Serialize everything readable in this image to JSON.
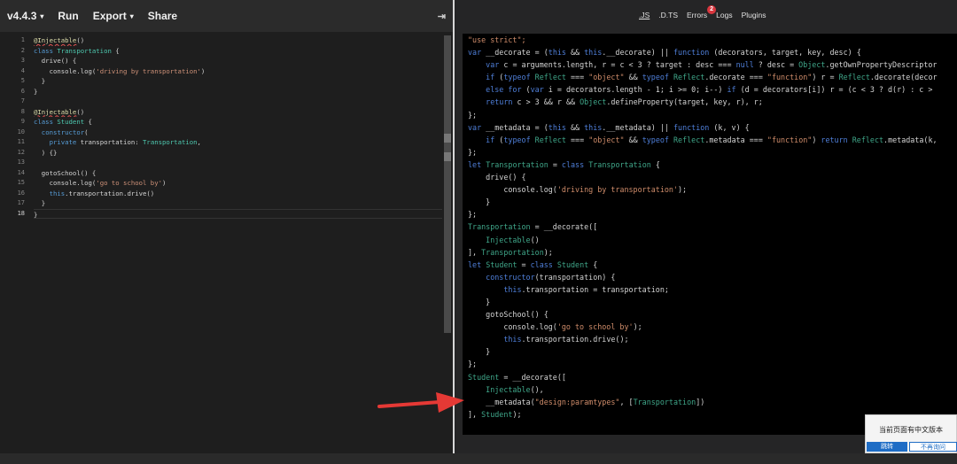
{
  "toolbar": {
    "version_label": "v4.4.3",
    "run_label": "Run",
    "export_label": "Export",
    "share_label": "Share",
    "collapse_glyph": "⇥",
    "caret": "▾"
  },
  "editor": {
    "line_numbers": [
      "1",
      "2",
      "3",
      "4",
      "5",
      "6",
      "7",
      "8",
      "9",
      "10",
      "11",
      "12",
      "13",
      "14",
      "15",
      "16",
      "17",
      "18"
    ],
    "source_lines": [
      [
        {
          "t": "@Injectable",
          "c": "deco err"
        },
        {
          "t": "()"
        }
      ],
      [
        {
          "t": "class ",
          "c": "kw"
        },
        {
          "t": "Transportation",
          "c": "cls"
        },
        {
          "t": " {"
        }
      ],
      [
        {
          "t": "  drive() {"
        }
      ],
      [
        {
          "t": "    console.log("
        },
        {
          "t": "'driving by transportation'",
          "c": "str"
        },
        {
          "t": ")"
        }
      ],
      [
        {
          "t": "  }"
        }
      ],
      [
        {
          "t": "}"
        }
      ],
      [
        {
          "t": ""
        }
      ],
      [
        {
          "t": "@Injectable",
          "c": "deco err"
        },
        {
          "t": "()"
        }
      ],
      [
        {
          "t": "class ",
          "c": "kw"
        },
        {
          "t": "Student",
          "c": "cls"
        },
        {
          "t": " {"
        }
      ],
      [
        {
          "t": "  "
        },
        {
          "t": "constructor",
          "c": "kw"
        },
        {
          "t": "("
        }
      ],
      [
        {
          "t": "    "
        },
        {
          "t": "private",
          "c": "kw"
        },
        {
          "t": " transportation: "
        },
        {
          "t": "Transportation",
          "c": "cls"
        },
        {
          "t": ","
        }
      ],
      [
        {
          "t": "  ) {}"
        }
      ],
      [
        {
          "t": ""
        }
      ],
      [
        {
          "t": "  gotoSchool() {"
        }
      ],
      [
        {
          "t": "    console.log("
        },
        {
          "t": "'go to school by'",
          "c": "str"
        },
        {
          "t": ")"
        }
      ],
      [
        {
          "t": "    "
        },
        {
          "t": "this",
          "c": "kw"
        },
        {
          "t": ".transportation.drive()"
        }
      ],
      [
        {
          "t": "  }"
        }
      ],
      [
        {
          "t": "}"
        }
      ]
    ]
  },
  "output_tabs": [
    {
      "label": ".JS",
      "active": true
    },
    {
      "label": ".D.TS",
      "active": false
    },
    {
      "label": "Errors",
      "active": false,
      "badge": "2"
    },
    {
      "label": "Logs",
      "active": false
    },
    {
      "label": "Plugins",
      "active": false
    }
  ],
  "output": {
    "lines": [
      [
        {
          "t": "\"use strict\";",
          "c": "str"
        }
      ],
      [
        {
          "t": "var",
          "c": "kw"
        },
        {
          "t": " __decorate = ("
        },
        {
          "t": "this",
          "c": "kw"
        },
        {
          "t": " && "
        },
        {
          "t": "this",
          "c": "kw"
        },
        {
          "t": ".__decorate) || "
        },
        {
          "t": "function",
          "c": "kw"
        },
        {
          "t": " (decorators, target, key, desc) {"
        }
      ],
      [
        {
          "t": "    "
        },
        {
          "t": "var",
          "c": "kw"
        },
        {
          "t": " c = arguments.length, r = c < 3 ? target : desc === "
        },
        {
          "t": "null",
          "c": "kw"
        },
        {
          "t": " ? desc = "
        },
        {
          "t": "Object",
          "c": "cls"
        },
        {
          "t": ".getOwnPropertyDescriptor"
        }
      ],
      [
        {
          "t": "    "
        },
        {
          "t": "if",
          "c": "kw"
        },
        {
          "t": " ("
        },
        {
          "t": "typeof",
          "c": "kw"
        },
        {
          "t": " "
        },
        {
          "t": "Reflect",
          "c": "cls"
        },
        {
          "t": " === "
        },
        {
          "t": "\"object\"",
          "c": "str"
        },
        {
          "t": " && "
        },
        {
          "t": "typeof",
          "c": "kw"
        },
        {
          "t": " "
        },
        {
          "t": "Reflect",
          "c": "cls"
        },
        {
          "t": ".decorate === "
        },
        {
          "t": "\"function\"",
          "c": "str"
        },
        {
          "t": ") r = "
        },
        {
          "t": "Reflect",
          "c": "cls"
        },
        {
          "t": ".decorate(decor"
        }
      ],
      [
        {
          "t": "    "
        },
        {
          "t": "else for",
          "c": "kw"
        },
        {
          "t": " ("
        },
        {
          "t": "var",
          "c": "kw"
        },
        {
          "t": " i = decorators.length - 1; i >= 0; i--) "
        },
        {
          "t": "if",
          "c": "kw"
        },
        {
          "t": " (d = decorators[i]) r = (c < 3 ? d(r) : c >"
        }
      ],
      [
        {
          "t": "    "
        },
        {
          "t": "return",
          "c": "kw"
        },
        {
          "t": " c > 3 && r && "
        },
        {
          "t": "Object",
          "c": "cls"
        },
        {
          "t": ".defineProperty(target, key, r), r;"
        }
      ],
      [
        {
          "t": "};"
        }
      ],
      [
        {
          "t": "var",
          "c": "kw"
        },
        {
          "t": " __metadata = ("
        },
        {
          "t": "this",
          "c": "kw"
        },
        {
          "t": " && "
        },
        {
          "t": "this",
          "c": "kw"
        },
        {
          "t": ".__metadata) || "
        },
        {
          "t": "function",
          "c": "kw"
        },
        {
          "t": " (k, v) {"
        }
      ],
      [
        {
          "t": "    "
        },
        {
          "t": "if",
          "c": "kw"
        },
        {
          "t": " ("
        },
        {
          "t": "typeof",
          "c": "kw"
        },
        {
          "t": " "
        },
        {
          "t": "Reflect",
          "c": "cls"
        },
        {
          "t": " === "
        },
        {
          "t": "\"object\"",
          "c": "str"
        },
        {
          "t": " && "
        },
        {
          "t": "typeof",
          "c": "kw"
        },
        {
          "t": " "
        },
        {
          "t": "Reflect",
          "c": "cls"
        },
        {
          "t": ".metadata === "
        },
        {
          "t": "\"function\"",
          "c": "str"
        },
        {
          "t": ") "
        },
        {
          "t": "return",
          "c": "kw"
        },
        {
          "t": " "
        },
        {
          "t": "Reflect",
          "c": "cls"
        },
        {
          "t": ".metadata(k,"
        }
      ],
      [
        {
          "t": "};"
        }
      ],
      [
        {
          "t": "let",
          "c": "kw"
        },
        {
          "t": " "
        },
        {
          "t": "Transportation",
          "c": "cls"
        },
        {
          "t": " = "
        },
        {
          "t": "class",
          "c": "kw"
        },
        {
          "t": " "
        },
        {
          "t": "Transportation",
          "c": "cls"
        },
        {
          "t": " {"
        }
      ],
      [
        {
          "t": "    drive() {"
        }
      ],
      [
        {
          "t": "        console.log("
        },
        {
          "t": "'driving by transportation'",
          "c": "str"
        },
        {
          "t": ");"
        }
      ],
      [
        {
          "t": "    }"
        }
      ],
      [
        {
          "t": "};"
        }
      ],
      [
        {
          "t": "Transportation",
          "c": "cls"
        },
        {
          "t": " = __decorate(["
        }
      ],
      [
        {
          "t": "    "
        },
        {
          "t": "Injectable",
          "c": "cls"
        },
        {
          "t": "()"
        }
      ],
      [
        {
          "t": "], "
        },
        {
          "t": "Transportation",
          "c": "cls"
        },
        {
          "t": ");"
        }
      ],
      [
        {
          "t": "let",
          "c": "kw"
        },
        {
          "t": " "
        },
        {
          "t": "Student",
          "c": "cls"
        },
        {
          "t": " = "
        },
        {
          "t": "class",
          "c": "kw"
        },
        {
          "t": " "
        },
        {
          "t": "Student",
          "c": "cls"
        },
        {
          "t": " {"
        }
      ],
      [
        {
          "t": "    "
        },
        {
          "t": "constructor",
          "c": "kw"
        },
        {
          "t": "(transportation) {"
        }
      ],
      [
        {
          "t": "        "
        },
        {
          "t": "this",
          "c": "kw"
        },
        {
          "t": ".transportation = transportation;"
        }
      ],
      [
        {
          "t": "    }"
        }
      ],
      [
        {
          "t": "    gotoSchool() {"
        }
      ],
      [
        {
          "t": "        console.log("
        },
        {
          "t": "'go to school by'",
          "c": "str"
        },
        {
          "t": ");"
        }
      ],
      [
        {
          "t": "        "
        },
        {
          "t": "this",
          "c": "kw"
        },
        {
          "t": ".transportation.drive();"
        }
      ],
      [
        {
          "t": "    }"
        }
      ],
      [
        {
          "t": "};"
        }
      ],
      [
        {
          "t": "Student",
          "c": "cls"
        },
        {
          "t": " = __decorate(["
        }
      ],
      [
        {
          "t": "    "
        },
        {
          "t": "Injectable",
          "c": "cls"
        },
        {
          "t": "(),"
        }
      ],
      [
        {
          "t": "    __metadata("
        },
        {
          "t": "\"design:paramtypes\"",
          "c": "str"
        },
        {
          "t": ", ["
        },
        {
          "t": "Transportation",
          "c": "cls"
        },
        {
          "t": "])"
        }
      ],
      [
        {
          "t": "], "
        },
        {
          "t": "Student",
          "c": "cls"
        },
        {
          "t": ");"
        }
      ]
    ]
  },
  "popup": {
    "message": "当前页面有中文版本",
    "go_label": "跳转",
    "dismiss_label": "不再询问"
  },
  "colors": {
    "keyword": "#569cd6",
    "class_name": "#4ec9b0",
    "string": "#ce9178",
    "annotation_arrow": "#e53935",
    "popup_button": "#1f6dc5"
  }
}
